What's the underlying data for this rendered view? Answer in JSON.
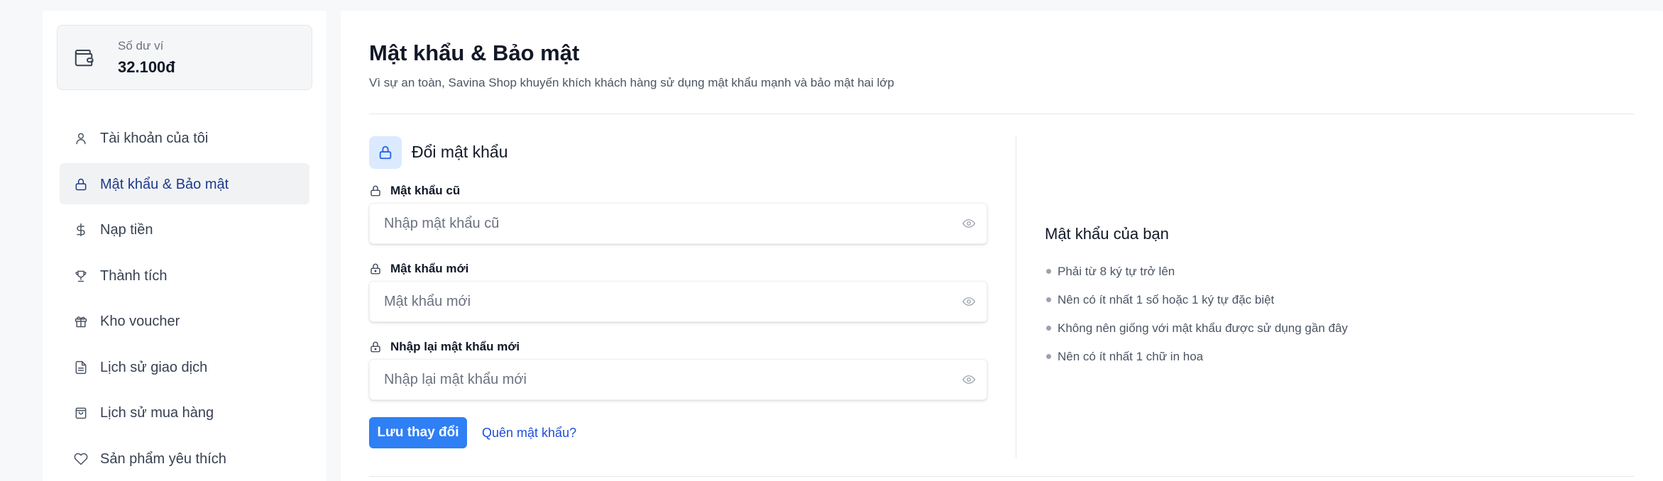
{
  "wallet": {
    "label": "Số dư ví",
    "value": "32.100đ",
    "icon": "wallet-icon"
  },
  "sidebar": {
    "items": [
      {
        "label": "Tài khoản của tôi",
        "icon": "user-icon",
        "active": false
      },
      {
        "label": "Mật khẩu & Bảo mật",
        "icon": "lock-icon",
        "active": true
      },
      {
        "label": "Nạp tiền",
        "icon": "dollar-icon",
        "active": false
      },
      {
        "label": "Thành tích",
        "icon": "trophy-icon",
        "active": false
      },
      {
        "label": "Kho voucher",
        "icon": "gift-icon",
        "active": false
      },
      {
        "label": "Lịch sử giao dịch",
        "icon": "document-icon",
        "active": false
      },
      {
        "label": "Lịch sử mua hàng",
        "icon": "shopping-bag-icon",
        "active": false
      },
      {
        "label": "Sản phẩm yêu thích",
        "icon": "heart-icon",
        "active": false
      }
    ]
  },
  "main": {
    "title": "Mật khẩu & Bảo mật",
    "subtitle": "Vì sự an toàn, Savina Shop khuyến khích khách hàng sử dụng mật khẩu mạnh và bảo mật hai lớp",
    "section_title": "Đổi mật khẩu",
    "fields": [
      {
        "label": "Mật khẩu cũ",
        "placeholder": "Nhập mật khẩu cũ",
        "value": ""
      },
      {
        "label": "Mật khẩu mới",
        "placeholder": "Mật khẩu mới",
        "value": ""
      },
      {
        "label": "Nhập lại mật khẩu mới",
        "placeholder": "Nhập lại mật khẩu mới",
        "value": ""
      }
    ],
    "save_label": "Lưu thay đổi",
    "forgot_label": "Quên mật khẩu?",
    "rules_title": "Mật khẩu của bạn",
    "rules": [
      "Phải từ 8 ký tự trở lên",
      "Nên có ít nhất 1 số hoặc 1 ký tự đặc biệt",
      "Không nên giống với mật khẩu được sử dụng gần đây",
      "Nên có ít nhất 1 chữ in hoa"
    ]
  },
  "colors": {
    "accent": "#2f7ff5",
    "active_text": "#1e3a8a",
    "link": "#1d4ed8",
    "icon_bg": "#dbeafe"
  }
}
